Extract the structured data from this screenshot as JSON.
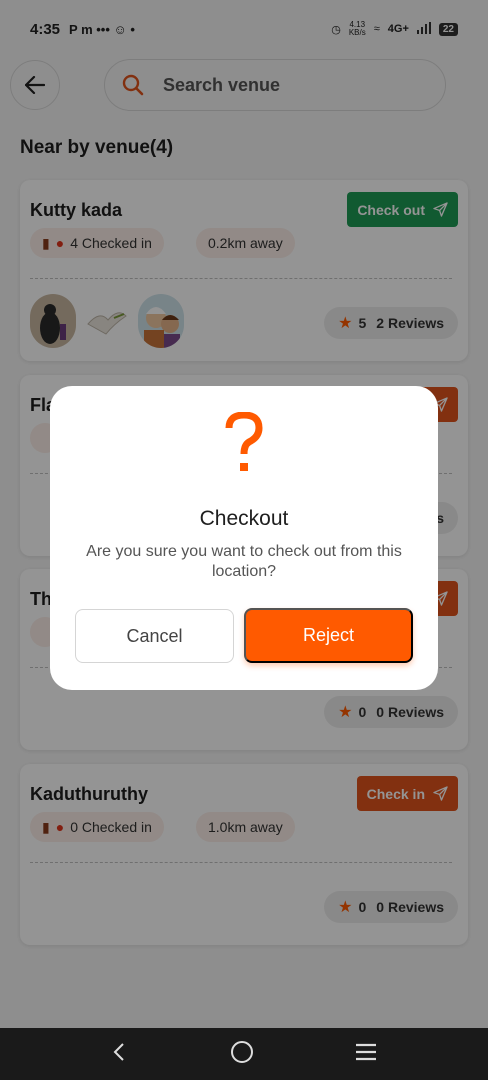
{
  "status_bar": {
    "time": "4:35",
    "left_icons": "P  m  •••  ☺  •",
    "network": "4G+",
    "speed": "4.13\nKB/s",
    "battery": "22"
  },
  "header": {
    "search_placeholder": "Search venue"
  },
  "section_title": "Near by venue(4)",
  "venues": [
    {
      "name": "Kutty kada",
      "action": "Check out",
      "action_color": "#1e9b55",
      "checked_in": "4 Checked in",
      "distance": "0.2km away",
      "rating": "5",
      "reviews": "2 Reviews"
    },
    {
      "name": "Fla",
      "action": "",
      "action_color": "#e1541c",
      "rating": "",
      "reviews": "s"
    },
    {
      "name": "Th",
      "action": "",
      "action_color": "#e1541c",
      "rating": "0",
      "reviews": "0 Reviews"
    },
    {
      "name": "Kaduthuruthy",
      "action": "Check in",
      "action_color": "#e1541c",
      "checked_in": "0 Checked in",
      "distance": "1.0km away",
      "rating": "0",
      "reviews": "0 Reviews"
    }
  ],
  "dialog": {
    "title": "Checkout",
    "message": "Are you sure you want to check out from this location?",
    "cancel_label": "Cancel",
    "confirm_label": "Reject"
  },
  "colors": {
    "accent": "#ff5a00",
    "checkout_green": "#1e9b55",
    "checkin_orange": "#e1541c"
  }
}
